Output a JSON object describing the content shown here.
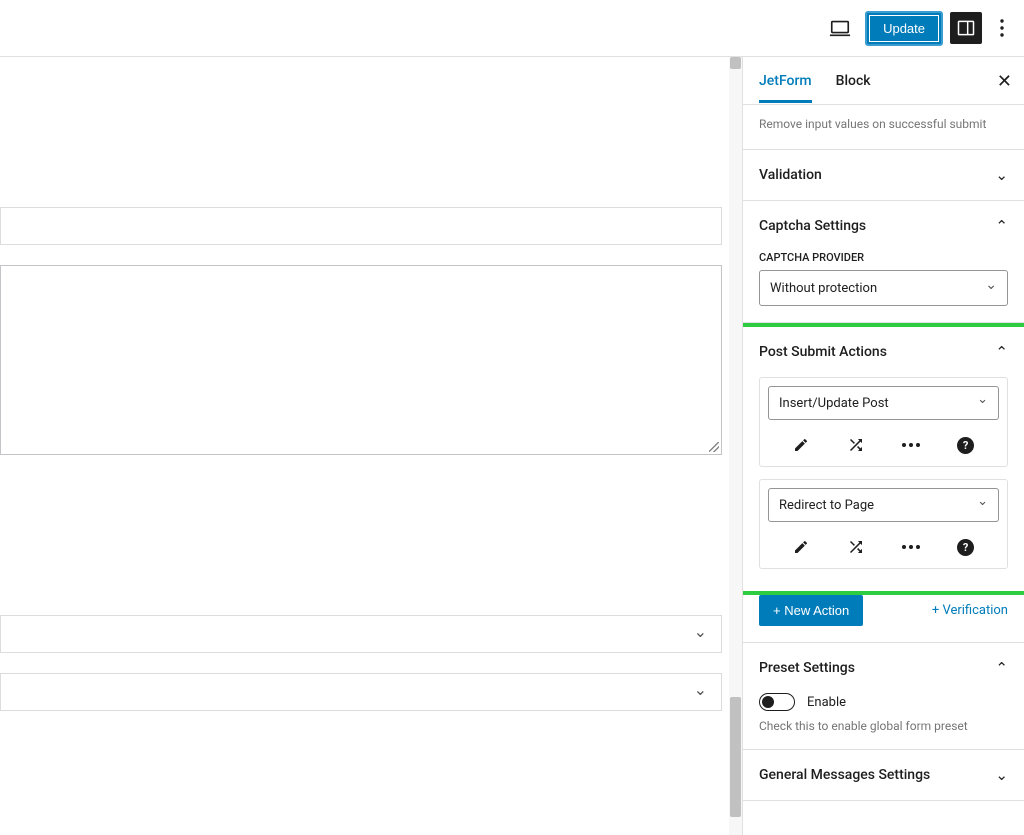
{
  "topbar": {
    "update_label": "Update"
  },
  "sidebar_tabs": {
    "jetform": "JetForm",
    "block": "Block"
  },
  "panel_notice": "Remove input values on successful submit",
  "panels": {
    "validation": {
      "title": "Validation"
    },
    "captcha": {
      "title": "Captcha Settings",
      "provider_label": "CAPTCHA PROVIDER",
      "provider_value": "Without protection"
    },
    "post_submit": {
      "title": "Post Submit Actions",
      "actions": [
        {
          "label": "Insert/Update Post"
        },
        {
          "label": "Redirect to Page"
        }
      ],
      "new_action": "+ New Action",
      "verification": "+ Verification"
    },
    "preset": {
      "title": "Preset Settings",
      "enable_label": "Enable",
      "help": "Check this to enable global form preset"
    },
    "messages": {
      "title": "General Messages Settings"
    }
  }
}
